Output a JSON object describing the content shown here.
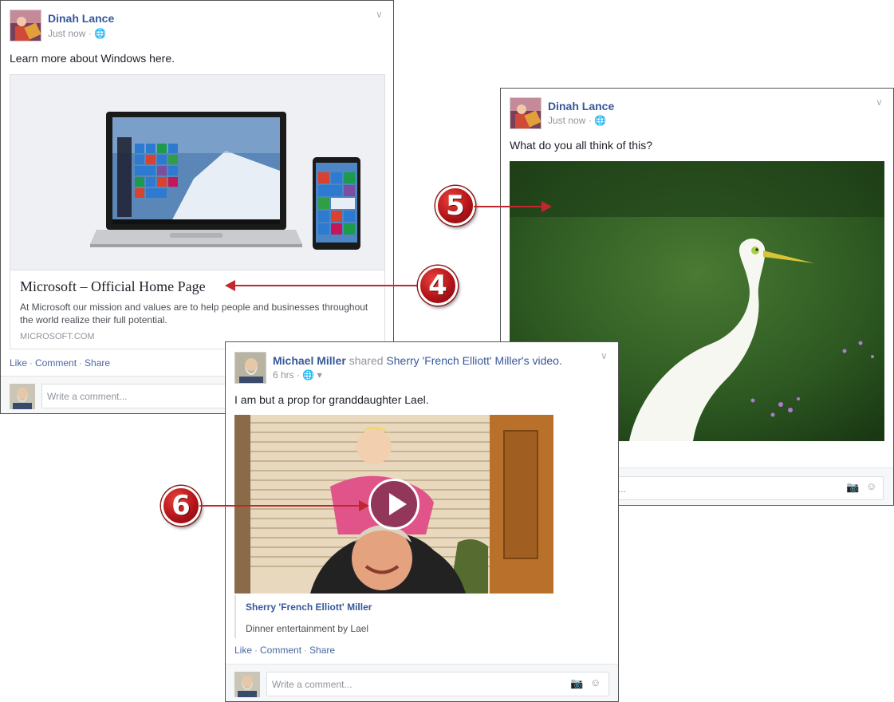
{
  "post1": {
    "author": "Dinah Lance",
    "time": "Just now",
    "text": "Learn more about Windows here.",
    "link_title": "Microsoft – Official Home Page",
    "link_desc_1": "At Microsoft our mission and values are to help people and businesses throughout",
    "link_desc_2": "the world realize their full potential.",
    "link_domain": "MICROSOFT.COM",
    "actions": {
      "like": "Like",
      "comment": "Comment",
      "share": "Share"
    },
    "comment_placeholder": "Write a comment..."
  },
  "post2": {
    "author": "Dinah Lance",
    "time": "Just now",
    "text": "What do you all think of this?",
    "comment_placeholder": "..."
  },
  "post3": {
    "author": "Michael Miller",
    "shared_text": "shared",
    "shared_owner": "Sherry 'French Elliott' Miller",
    "shared_suffix": "'s",
    "shared_object": "video.",
    "time": "6 hrs",
    "text": "I am but a prop for granddaughter Lael.",
    "video_owner": "Sherry 'French Elliott' Miller",
    "video_desc": "Dinner entertainment by Lael",
    "actions": {
      "like": "Like",
      "comment": "Comment",
      "share": "Share"
    },
    "comment_placeholder": "Write a comment..."
  },
  "callouts": {
    "c4": "4",
    "c5": "5",
    "c6": "6"
  },
  "icons": {
    "globe": "globe-icon",
    "chevron": "chevron-down-icon",
    "camera": "camera-icon",
    "smiley": "smiley-icon",
    "play": "play-icon"
  },
  "colors": {
    "link": "#365899",
    "callout": "#c1272d"
  }
}
